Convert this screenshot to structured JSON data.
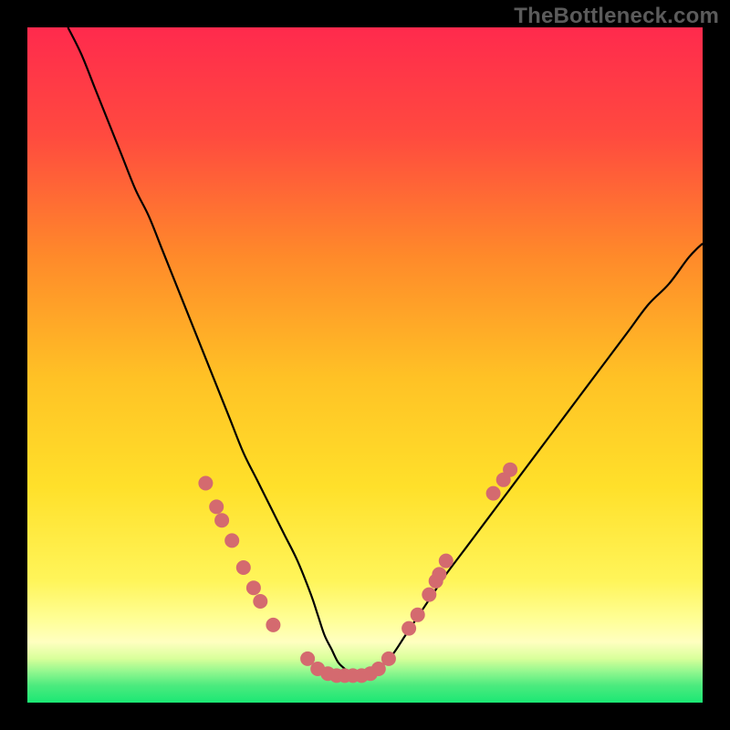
{
  "watermark": "TheBottleneck.com",
  "colors": {
    "frame": "#000000",
    "curve": "#000000",
    "dot_fill": "#d46a6f",
    "dot_stroke": "#bb5057",
    "grad_top": "#ff2a4d",
    "grad_mid1": "#ff8a2a",
    "grad_mid2": "#ffe02a",
    "grad_mid3": "#ffff8a",
    "grad_bottom": "#1be874"
  },
  "chart_data": {
    "type": "line",
    "title": "",
    "xlabel": "",
    "ylabel": "",
    "xlim": [
      0,
      100
    ],
    "ylim": [
      0,
      100
    ],
    "series": [
      {
        "name": "bottleneck-curve",
        "x": [
          6,
          8,
          10,
          12,
          14,
          16,
          18,
          20,
          22,
          24,
          26,
          28,
          30,
          32,
          34,
          36,
          38,
          40,
          42,
          43,
          44,
          45,
          46,
          47,
          48,
          49,
          50,
          52,
          54,
          56,
          58,
          60,
          62,
          65,
          68,
          71,
          74,
          77,
          80,
          83,
          86,
          89,
          92,
          95,
          98,
          100
        ],
        "y": [
          100,
          96,
          91,
          86,
          81,
          76,
          72,
          67,
          62,
          57,
          52,
          47,
          42,
          37,
          33,
          29,
          25,
          21,
          16,
          13,
          10,
          8,
          6,
          5,
          4,
          4,
          4,
          5,
          7,
          10,
          13,
          16,
          19,
          23,
          27,
          31,
          35,
          39,
          43,
          47,
          51,
          55,
          59,
          62,
          66,
          68
        ]
      }
    ],
    "points": [
      {
        "x": 26.4,
        "y": 32.5
      },
      {
        "x": 28.0,
        "y": 29.0
      },
      {
        "x": 28.8,
        "y": 27.0
      },
      {
        "x": 30.3,
        "y": 24.0
      },
      {
        "x": 32.0,
        "y": 20.0
      },
      {
        "x": 33.5,
        "y": 17.0
      },
      {
        "x": 34.5,
        "y": 15.0
      },
      {
        "x": 36.4,
        "y": 11.5
      },
      {
        "x": 41.5,
        "y": 6.5
      },
      {
        "x": 43.0,
        "y": 5.0
      },
      {
        "x": 44.5,
        "y": 4.3
      },
      {
        "x": 45.8,
        "y": 4.0
      },
      {
        "x": 47.0,
        "y": 4.0
      },
      {
        "x": 48.2,
        "y": 4.0
      },
      {
        "x": 49.5,
        "y": 4.0
      },
      {
        "x": 50.8,
        "y": 4.3
      },
      {
        "x": 52.0,
        "y": 5.0
      },
      {
        "x": 53.5,
        "y": 6.5
      },
      {
        "x": 56.5,
        "y": 11.0
      },
      {
        "x": 57.8,
        "y": 13.0
      },
      {
        "x": 59.5,
        "y": 16.0
      },
      {
        "x": 60.5,
        "y": 18.0
      },
      {
        "x": 61.0,
        "y": 19.0
      },
      {
        "x": 62.0,
        "y": 21.0
      },
      {
        "x": 69.0,
        "y": 31.0
      },
      {
        "x": 70.5,
        "y": 33.0
      },
      {
        "x": 71.5,
        "y": 34.5
      }
    ],
    "gradient_bands": [
      {
        "y_from": 100,
        "y_to": 12,
        "type": "continuous",
        "top": "#ff2a4d",
        "bottom": "#ffff8a"
      },
      {
        "y_from": 12,
        "y_to": 6,
        "type": "continuous",
        "top": "#ffff8a",
        "bottom": "#d8ff7a"
      },
      {
        "y_from": 6,
        "y_to": 0,
        "type": "continuous",
        "top": "#59f28f",
        "bottom": "#1be874"
      }
    ]
  }
}
